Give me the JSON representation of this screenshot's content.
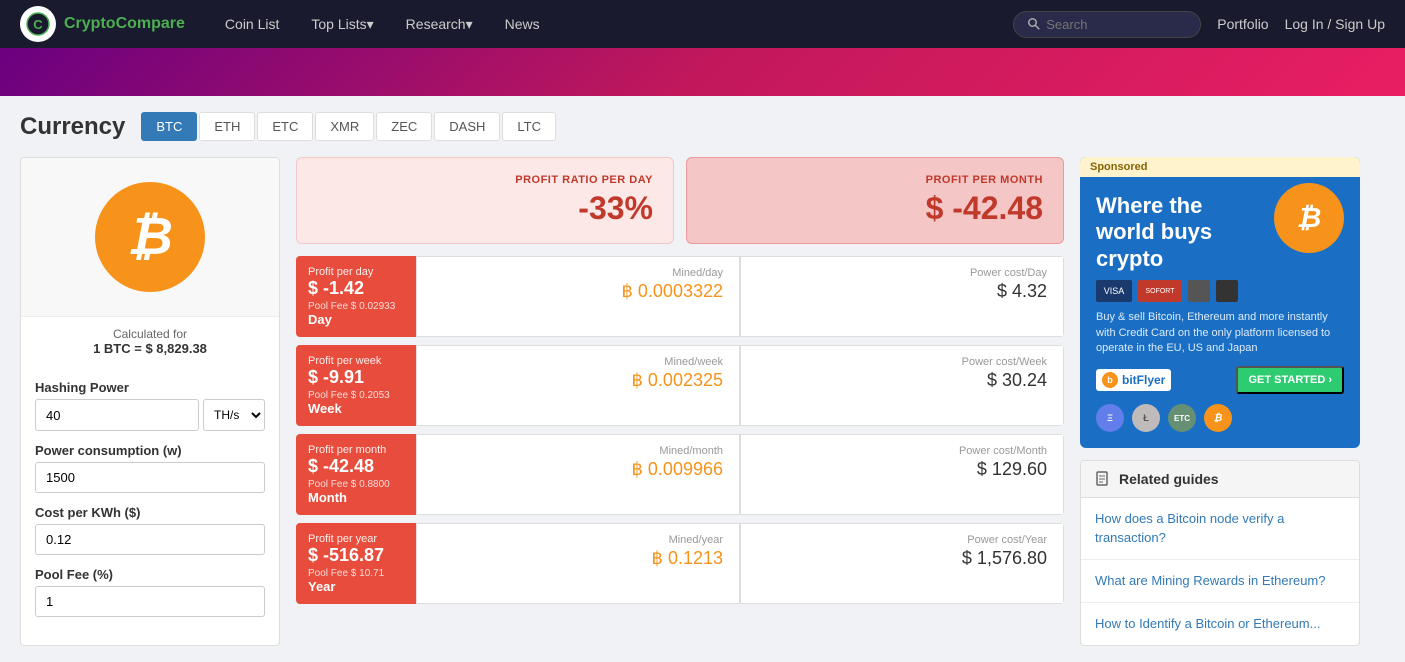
{
  "nav": {
    "logo_text_plain": "Crypto",
    "logo_text_accent": "Compare",
    "links": [
      {
        "label": "Coin List",
        "id": "coin-list"
      },
      {
        "label": "Top Lists",
        "id": "top-lists",
        "has_arrow": true
      },
      {
        "label": "Research",
        "id": "research",
        "has_arrow": true
      },
      {
        "label": "News",
        "id": "news"
      }
    ],
    "search_placeholder": "Search",
    "portfolio": "Portfolio",
    "login": "Log In / Sign Up"
  },
  "page": {
    "title": "Currency",
    "tabs": [
      {
        "label": "BTC",
        "active": true
      },
      {
        "label": "ETH",
        "active": false
      },
      {
        "label": "ETC",
        "active": false
      },
      {
        "label": "XMR",
        "active": false
      },
      {
        "label": "ZEC",
        "active": false
      },
      {
        "label": "DASH",
        "active": false
      },
      {
        "label": "LTC",
        "active": false
      }
    ]
  },
  "btc_icon": "₿",
  "calculated_for": "Calculated for",
  "btc_price": "1 BTC = $ 8,829.38",
  "fields": {
    "hashing_power": {
      "label": "Hashing Power",
      "value": "40",
      "unit": "TH/s"
    },
    "power_consumption": {
      "label": "Power consumption (w)",
      "value": "1500"
    },
    "cost_per_kwh": {
      "label": "Cost per KWh ($)",
      "value": "0.12"
    },
    "pool_fee": {
      "label": "Pool Fee (%)",
      "value": "1"
    }
  },
  "profit_summary": {
    "ratio_label": "PROFIT RATIO PER DAY",
    "ratio_value": "-33%",
    "month_label": "PROFIT PER MONTH",
    "month_value": "$ -42.48"
  },
  "rows": [
    {
      "period": "Day",
      "row_label": "Profit per day",
      "profit_value": "$ -1.42",
      "pool_fee": "Pool Fee $ 0.02933",
      "mined_label": "Mined/day",
      "mined_value": "฿ 0.0003322",
      "power_label": "Power cost/Day",
      "power_value": "$ 4.32"
    },
    {
      "period": "Week",
      "row_label": "Profit per week",
      "profit_value": "$ -9.91",
      "pool_fee": "Pool Fee $ 0.2053",
      "mined_label": "Mined/week",
      "mined_value": "฿ 0.002325",
      "power_label": "Power cost/Week",
      "power_value": "$ 30.24"
    },
    {
      "period": "Month",
      "row_label": "Profit per month",
      "profit_value": "$ -42.48",
      "pool_fee": "Pool Fee $ 0.8800",
      "mined_label": "Mined/month",
      "mined_value": "฿ 0.009966",
      "power_label": "Power cost/Month",
      "power_value": "$ 129.60"
    },
    {
      "period": "Year",
      "row_label": "Profit per year",
      "profit_value": "$ -516.87",
      "pool_fee": "Pool Fee $ 10.71",
      "mined_label": "Mined/year",
      "mined_value": "฿ 0.1213",
      "power_label": "Power cost/Year",
      "power_value": "$ 1,576.80"
    }
  ],
  "ad": {
    "sponsored_label": "Sponsored",
    "title": "Where the world buys crypto",
    "description": "Buy & sell Bitcoin, Ethereum and more instantly with Credit Card on the only platform licensed to operate in the EU, US and Japan",
    "brand": "bitFlyer",
    "cta": "GET STARTED ›"
  },
  "guides": {
    "header": "Related guides",
    "items": [
      "How does a Bitcoin node verify a transaction?",
      "What are Mining Rewards in Ethereum?",
      "How to Identify a Bitcoin or Ethereum..."
    ]
  }
}
